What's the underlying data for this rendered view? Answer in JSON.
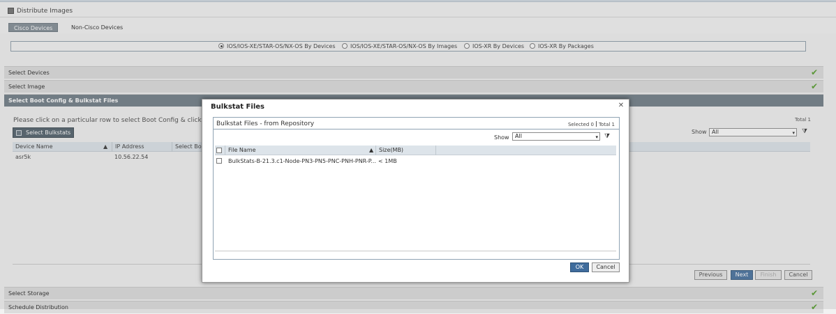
{
  "header": {
    "title": "Distribute Images"
  },
  "tabs": [
    {
      "label": "Cisco Devices",
      "active": true
    },
    {
      "label": "Non-Cisco Devices",
      "active": false
    }
  ],
  "radio_options": [
    {
      "label": "IOS/IOS-XE/STAR-OS/NX-OS By Devices",
      "selected": true
    },
    {
      "label": "IOS/IOS-XE/STAR-OS/NX-OS By Images",
      "selected": false
    },
    {
      "label": "IOS-XR By Devices",
      "selected": false
    },
    {
      "label": "IOS-XR By Packages",
      "selected": false
    }
  ],
  "sections": {
    "select_devices": "Select Devices",
    "select_image": "Select Image",
    "select_boot": "Select Boot Config & Bulkstat Files",
    "select_storage": "Select Storage",
    "schedule": "Schedule Distribution"
  },
  "panel": {
    "instruction": "Please click on a particular row to select Boot Config & click Bulkst",
    "total": "Total 1",
    "select_bulkstats_label": "Select Bulkstats",
    "show_label": "Show",
    "show_value": "All",
    "columns": [
      "Device Name",
      "IP Address",
      "Select Boo"
    ],
    "rows": [
      {
        "device": "asr5k",
        "ip": "10.56.22.54"
      }
    ]
  },
  "footer": {
    "previous": "Previous",
    "next": "Next",
    "finish": "Finish",
    "cancel": "Cancel"
  },
  "modal": {
    "title": "Bulkstat Files",
    "subtitle": "Bulkstat Files - from Repository",
    "selected": "Selected 0",
    "total": "Total 1",
    "show_label": "Show",
    "show_value": "All",
    "columns": {
      "file_name": "File Name",
      "size": "Size(MB)"
    },
    "rows": [
      {
        "file_name": "BulkStats-B-21.3.c1-Node-PN3-PN5-PNC-PNH-PNR-P...",
        "size": "< 1MB"
      }
    ],
    "ok": "OK",
    "cancel": "Cancel"
  },
  "colors": {
    "accent": "#3f6c9c",
    "section_active": "#6b7882",
    "check": "#4e9a22"
  }
}
